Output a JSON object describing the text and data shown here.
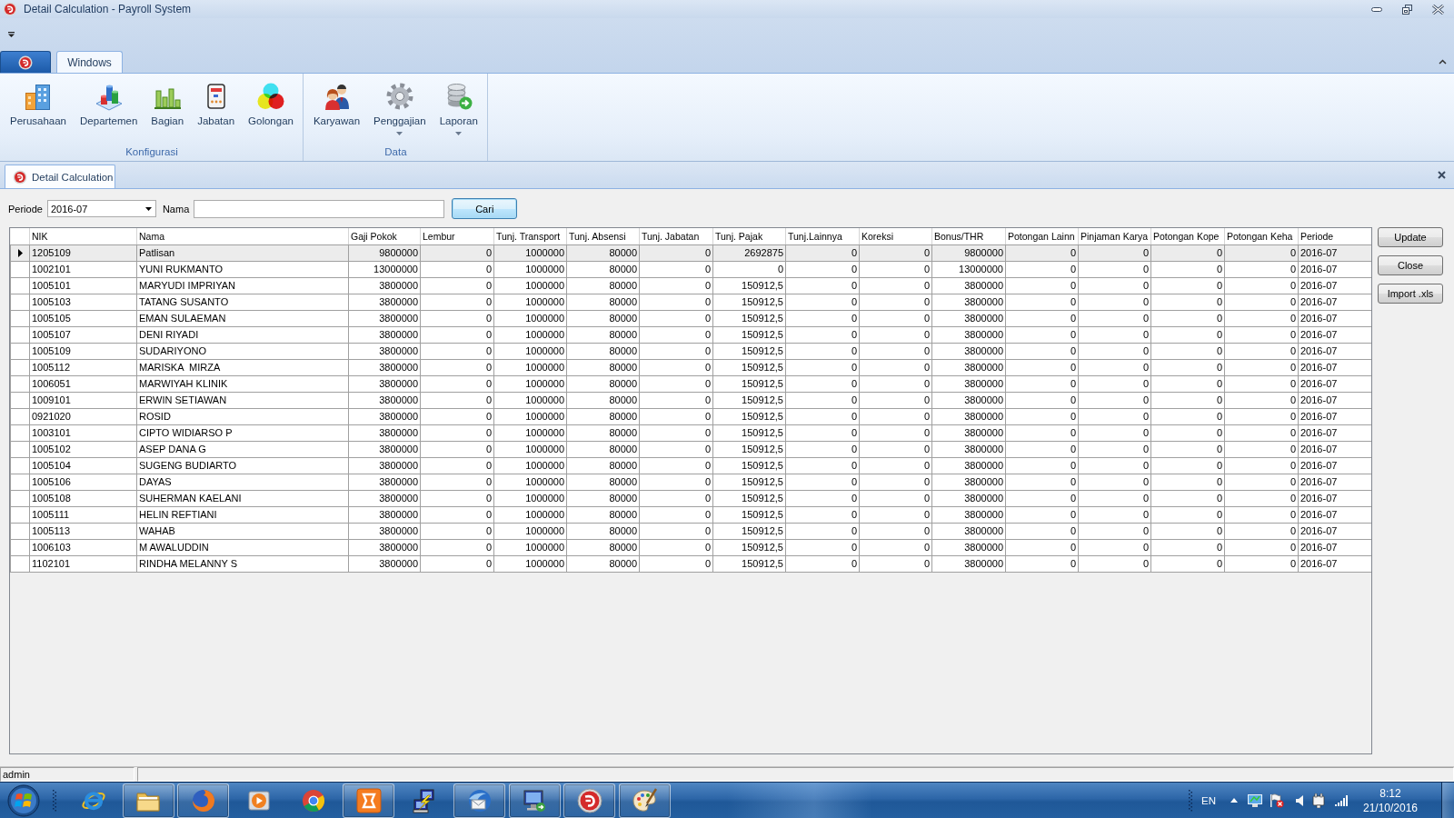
{
  "window": {
    "title": "Detail Calculation - Payroll System"
  },
  "ribbon": {
    "tabs": [
      {
        "label": "Windows",
        "selected": true
      }
    ],
    "groups": [
      {
        "label": "Konfigurasi",
        "items": [
          {
            "label": "Perusahaan",
            "dropdown": false
          },
          {
            "label": "Departemen",
            "dropdown": false
          },
          {
            "label": "Bagian",
            "dropdown": false
          },
          {
            "label": "Jabatan",
            "dropdown": false
          },
          {
            "label": "Golongan",
            "dropdown": false
          }
        ]
      },
      {
        "label": "Data",
        "items": [
          {
            "label": "Karyawan",
            "dropdown": false
          },
          {
            "label": "Penggajian",
            "dropdown": true
          },
          {
            "label": "Laporan",
            "dropdown": true
          }
        ]
      }
    ]
  },
  "document_tabs": [
    {
      "label": "Detail Calculation",
      "selected": true
    }
  ],
  "filter": {
    "periode": {
      "label": "Periode",
      "value": "2016-07"
    },
    "nama": {
      "label": "Nama"
    },
    "search_button": {
      "label": "Cari",
      "focused": true
    }
  },
  "table": {
    "columns": [
      {
        "label": "NIK",
        "kind": "text"
      },
      {
        "label": "Nama",
        "kind": "text"
      },
      {
        "label": "Gaji Pokok",
        "kind": "number"
      },
      {
        "label": "Lembur",
        "kind": "number"
      },
      {
        "label": "Tunj. Transport",
        "kind": "number"
      },
      {
        "label": "Tunj. Absensi",
        "kind": "number"
      },
      {
        "label": "Tunj. Jabatan",
        "kind": "number"
      },
      {
        "label": "Tunj. Pajak",
        "kind": "number"
      },
      {
        "label": "Tunj.Lainnya",
        "kind": "number"
      },
      {
        "label": "Koreksi",
        "kind": "number"
      },
      {
        "label": "Bonus/THR",
        "kind": "number"
      },
      {
        "label": "Potongan Lainn",
        "kind": "number"
      },
      {
        "label": "Pinjaman Karya",
        "kind": "number"
      },
      {
        "label": "Potongan Kope",
        "kind": "number"
      },
      {
        "label": "Potongan Keha",
        "kind": "number"
      },
      {
        "label": "Periode",
        "kind": "text"
      }
    ],
    "rows": [
      {
        "selected": true,
        "cells": [
          "1205109",
          "Patlisan",
          "9800000",
          "0",
          "1000000",
          "80000",
          "0",
          "2692875",
          "0",
          "0",
          "9800000",
          "0",
          "0",
          "0",
          "0",
          "2016-07"
        ]
      },
      {
        "selected": false,
        "cells": [
          "1002101",
          "YUNI RUKMANTO",
          "13000000",
          "0",
          "1000000",
          "80000",
          "0",
          "0",
          "0",
          "0",
          "13000000",
          "0",
          "0",
          "0",
          "0",
          "2016-07"
        ]
      },
      {
        "selected": false,
        "cells": [
          "1005101",
          "MARYUDI IMPRIYAN",
          "3800000",
          "0",
          "1000000",
          "80000",
          "0",
          "150912,5",
          "0",
          "0",
          "3800000",
          "0",
          "0",
          "0",
          "0",
          "2016-07"
        ]
      },
      {
        "selected": false,
        "cells": [
          "1005103",
          "TATANG SUSANTO",
          "3800000",
          "0",
          "1000000",
          "80000",
          "0",
          "150912,5",
          "0",
          "0",
          "3800000",
          "0",
          "0",
          "0",
          "0",
          "2016-07"
        ]
      },
      {
        "selected": false,
        "cells": [
          "1005105",
          "EMAN SULAEMAN",
          "3800000",
          "0",
          "1000000",
          "80000",
          "0",
          "150912,5",
          "0",
          "0",
          "3800000",
          "0",
          "0",
          "0",
          "0",
          "2016-07"
        ]
      },
      {
        "selected": false,
        "cells": [
          "1005107",
          "DENI RIYADI",
          "3800000",
          "0",
          "1000000",
          "80000",
          "0",
          "150912,5",
          "0",
          "0",
          "3800000",
          "0",
          "0",
          "0",
          "0",
          "2016-07"
        ]
      },
      {
        "selected": false,
        "cells": [
          "1005109",
          "SUDARIYONO",
          "3800000",
          "0",
          "1000000",
          "80000",
          "0",
          "150912,5",
          "0",
          "0",
          "3800000",
          "0",
          "0",
          "0",
          "0",
          "2016-07"
        ]
      },
      {
        "selected": false,
        "cells": [
          "1005112",
          "MARISKA  MIRZA",
          "3800000",
          "0",
          "1000000",
          "80000",
          "0",
          "150912,5",
          "0",
          "0",
          "3800000",
          "0",
          "0",
          "0",
          "0",
          "2016-07"
        ]
      },
      {
        "selected": false,
        "cells": [
          "1006051",
          "MARWIYAH KLINIK",
          "3800000",
          "0",
          "1000000",
          "80000",
          "0",
          "150912,5",
          "0",
          "0",
          "3800000",
          "0",
          "0",
          "0",
          "0",
          "2016-07"
        ]
      },
      {
        "selected": false,
        "cells": [
          "1009101",
          "ERWIN SETIAWAN",
          "3800000",
          "0",
          "1000000",
          "80000",
          "0",
          "150912,5",
          "0",
          "0",
          "3800000",
          "0",
          "0",
          "0",
          "0",
          "2016-07"
        ]
      },
      {
        "selected": false,
        "cells": [
          "0921020",
          "ROSID",
          "3800000",
          "0",
          "1000000",
          "80000",
          "0",
          "150912,5",
          "0",
          "0",
          "3800000",
          "0",
          "0",
          "0",
          "0",
          "2016-07"
        ]
      },
      {
        "selected": false,
        "cells": [
          "1003101",
          "CIPTO WIDIARSO P",
          "3800000",
          "0",
          "1000000",
          "80000",
          "0",
          "150912,5",
          "0",
          "0",
          "3800000",
          "0",
          "0",
          "0",
          "0",
          "2016-07"
        ]
      },
      {
        "selected": false,
        "cells": [
          "1005102",
          "ASEP DANA G",
          "3800000",
          "0",
          "1000000",
          "80000",
          "0",
          "150912,5",
          "0",
          "0",
          "3800000",
          "0",
          "0",
          "0",
          "0",
          "2016-07"
        ]
      },
      {
        "selected": false,
        "cells": [
          "1005104",
          "SUGENG BUDIARTO",
          "3800000",
          "0",
          "1000000",
          "80000",
          "0",
          "150912,5",
          "0",
          "0",
          "3800000",
          "0",
          "0",
          "0",
          "0",
          "2016-07"
        ]
      },
      {
        "selected": false,
        "cells": [
          "1005106",
          "DAYAS",
          "3800000",
          "0",
          "1000000",
          "80000",
          "0",
          "150912,5",
          "0",
          "0",
          "3800000",
          "0",
          "0",
          "0",
          "0",
          "2016-07"
        ]
      },
      {
        "selected": false,
        "cells": [
          "1005108",
          "SUHERMAN KAELANI",
          "3800000",
          "0",
          "1000000",
          "80000",
          "0",
          "150912,5",
          "0",
          "0",
          "3800000",
          "0",
          "0",
          "0",
          "0",
          "2016-07"
        ]
      },
      {
        "selected": false,
        "cells": [
          "1005111",
          "HELIN REFTIANI",
          "3800000",
          "0",
          "1000000",
          "80000",
          "0",
          "150912,5",
          "0",
          "0",
          "3800000",
          "0",
          "0",
          "0",
          "0",
          "2016-07"
        ]
      },
      {
        "selected": false,
        "cells": [
          "1005113",
          "WAHAB",
          "3800000",
          "0",
          "1000000",
          "80000",
          "0",
          "150912,5",
          "0",
          "0",
          "3800000",
          "0",
          "0",
          "0",
          "0",
          "2016-07"
        ]
      },
      {
        "selected": false,
        "cells": [
          "1006103",
          "M AWALUDDIN",
          "3800000",
          "0",
          "1000000",
          "80000",
          "0",
          "150912,5",
          "0",
          "0",
          "3800000",
          "0",
          "0",
          "0",
          "0",
          "2016-07"
        ]
      },
      {
        "selected": false,
        "cells": [
          "1102101",
          "RINDHA MELANNY S",
          "3800000",
          "0",
          "1000000",
          "80000",
          "0",
          "150912,5",
          "0",
          "0",
          "3800000",
          "0",
          "0",
          "0",
          "0",
          "2016-07"
        ]
      }
    ]
  },
  "side_buttons": [
    {
      "label": "Update"
    },
    {
      "label": "Close"
    },
    {
      "label": "Import .xls"
    }
  ],
  "status_bar": {
    "user": "admin"
  },
  "taskbar": {
    "apps": [
      {
        "running": false
      },
      {
        "running": true
      },
      {
        "running": true
      },
      {
        "running": false
      },
      {
        "running": false
      },
      {
        "running": true
      },
      {
        "running": false
      },
      {
        "running": true
      },
      {
        "running": true
      },
      {
        "running": true
      },
      {
        "running": true
      }
    ],
    "tray": {
      "language": "EN",
      "time": "8:12",
      "date": "21/10/2016"
    }
  }
}
